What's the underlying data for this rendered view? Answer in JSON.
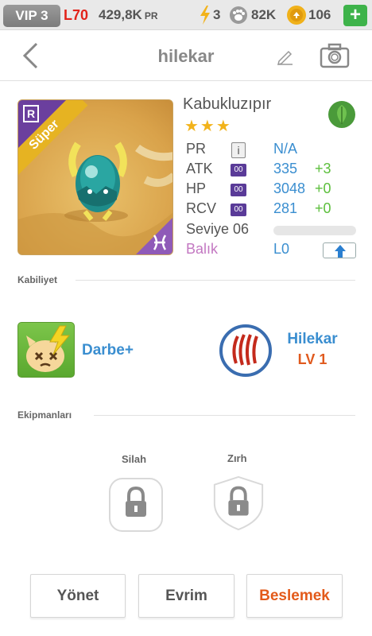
{
  "topbar": {
    "vip": "VIP 3",
    "level": "L70",
    "pr_value": "429,8K",
    "pr_suffix": "PR",
    "energy": "3",
    "paw": "82K",
    "coins": "106",
    "plus": "+"
  },
  "header": {
    "title": "hilekar",
    "back_icon": "chevron-left-icon",
    "edit_icon": "pencil-icon",
    "camera_icon": "camera-icon"
  },
  "pet": {
    "rarity_badge": "R",
    "ribbon": "Süper",
    "name": "Kabukluzıpır",
    "stars": "★★★",
    "element_icon": "leaf-icon",
    "zodiac_icon": "pisces-icon",
    "stats": [
      {
        "label": "PR",
        "value": "N/A",
        "bonus": ""
      },
      {
        "label": "ATK",
        "badge": "00",
        "value": "335",
        "bonus": "+3"
      },
      {
        "label": "HP",
        "badge": "00",
        "value": "3048",
        "bonus": "+0"
      },
      {
        "label": "RCV",
        "badge": "00",
        "value": "281",
        "bonus": "+0"
      }
    ],
    "info_icon": "i",
    "level_label": "Seviye 06",
    "xp_progress": 0.0,
    "zodiac_label": "Balık",
    "zodiac_level": "L0"
  },
  "abilities": {
    "section_title": "Kabiliyet",
    "skill_name": "Darbe+",
    "ability_name": "Hilekar",
    "ability_level": "LV 1"
  },
  "equipment": {
    "section_title": "Ekipmanları",
    "slots": [
      {
        "label": "Silah"
      },
      {
        "label": "Zırh"
      }
    ]
  },
  "buttons": {
    "manage": "Yönet",
    "evolve": "Evrim",
    "feed": "Beslemek"
  },
  "colors": {
    "accent_blue": "#3a8ed0",
    "bonus_green": "#5cbf3c",
    "danger_orange": "#e35a1a",
    "zodiac_pink": "#c378c2"
  }
}
